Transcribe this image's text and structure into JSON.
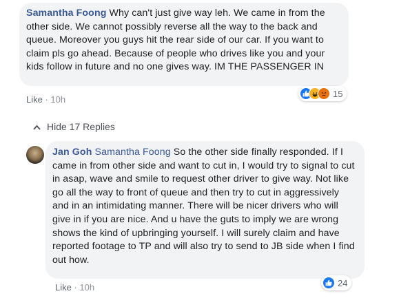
{
  "comment1": {
    "author": "Samantha Foong",
    "text": " Why can't just give way leh. We came in from the other side. We cannot possibly reverse all the way to the back and queue. Moreover you guys hit the rear side of our car. If you want to claim pls go ahead. Because of people who drives like you and your kids follow in future and no one gives way. IM THE PASSENGER IN",
    "like_label": "Like",
    "separator": " · ",
    "time": "10h",
    "reaction_icons": [
      "like-icon",
      "haha-icon",
      "angry-icon"
    ],
    "reaction_count": "15"
  },
  "replies_toggle": {
    "label": "Hide 17 Replies"
  },
  "comment2": {
    "author": "Jan Goh",
    "mention": "Samantha Foong",
    "text": " So the other side finally responded. If I came in from other side and want to cut in, I would try to signal to cut in asap, wave and smile to request other driver to give way. Not like go all the way to front of queue and then try to cut in aggressively and in an intimidating manner. There will be nicer drivers who will give in if you are nice. And u have the guts to imply we are wrong shows the kind of upbringing yourself. I will surely claim and have reported footage to TP and will also try to send to JB side when I find out how.",
    "like_label": "Like",
    "separator": " · ",
    "time": "10h",
    "reaction_icons": [
      "like-icon"
    ],
    "reaction_count": "24"
  },
  "colors": {
    "author_blue": "#385898",
    "bubble_bg": "#f2f3f5",
    "like_blue": "#1877f2",
    "haha_yellow": "#f7b125",
    "angry_red": "#e9710f"
  }
}
